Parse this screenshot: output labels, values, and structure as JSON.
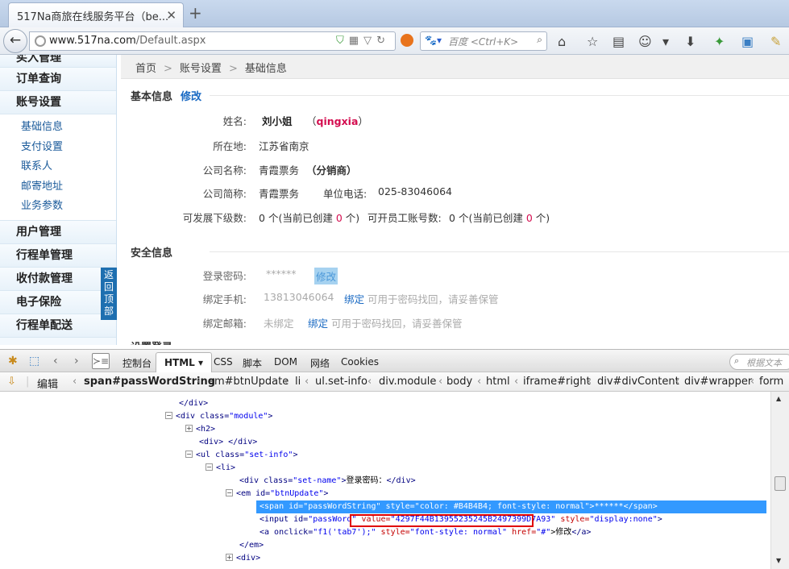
{
  "browser": {
    "tab_title": "517Na商旅在线服务平台（be...",
    "url_host": "www.517na.com",
    "url_path": "/Default.aspx",
    "search_placeholder": "百度 <Ctrl+K>"
  },
  "sidebar": {
    "items": [
      {
        "label": "买入管理",
        "type": "main"
      },
      {
        "label": "订单查询",
        "type": "main"
      },
      {
        "label": "账号设置",
        "type": "main"
      }
    ],
    "sub_items": [
      "基础信息",
      "支付设置",
      "联系人",
      "邮寄地址",
      "业务参数"
    ],
    "items_after": [
      "用户管理",
      "行程单管理",
      "收付款管理",
      "电子保险",
      "行程单配送"
    ],
    "back_to_top": [
      "返",
      "回",
      "顶",
      "部"
    ]
  },
  "breadcrumb": [
    "首页",
    "账号设置",
    "基础信息"
  ],
  "basic_info": {
    "title": "基本信息",
    "edit_link": "修改",
    "name_label": "姓名:",
    "name_value": "刘小姐",
    "username": "qingxia",
    "location_label": "所在地:",
    "location_value": "江苏省南京",
    "company_label": "公司名称:",
    "company_value": "青霞票务",
    "company_type": "分销商",
    "short_label": "公司简称:",
    "short_value": "青霞票务",
    "phone_label": "单位电话:",
    "phone_value": "025-83046064",
    "sub_label": "可发展下级数:",
    "sub_count": "0",
    "sub_text_a": "个(当前已创建",
    "sub_created": "0",
    "sub_text_b": "个)",
    "staff_label": "可开员工账号数:",
    "staff_count": "0",
    "staff_created": "0"
  },
  "security_info": {
    "title": "安全信息",
    "password_label": "登录密码:",
    "password_mask": "******",
    "password_edit": "修改",
    "phone_label": "绑定手机:",
    "phone_value": "13813046064",
    "bind_link": "绑定",
    "bind_hint": "可用于密码找回，请妥善保管",
    "email_label": "绑定邮箱:",
    "email_value": "未绑定",
    "email_bind_link": "绑定",
    "email_hint": "可用于密码找回，请妥善保管",
    "next_section_partial": "设置登录"
  },
  "firebug": {
    "tabs": [
      "控制台",
      "HTML",
      "CSS",
      "脚本",
      "DOM",
      "网络",
      "Cookies"
    ],
    "active_tab": "HTML",
    "search_placeholder": "根据文本",
    "edit_label": "编辑",
    "crumbs": [
      "span#passWordString",
      "em#btnUpdate",
      "li",
      "ul.set-info",
      "div.module",
      "body",
      "html",
      "iframe#right",
      "div#divContent",
      "div#wrapper",
      "form"
    ],
    "lines": [
      {
        "tag": "</div>"
      },
      {
        "open": "<div class=",
        "cls": "\"module\"",
        "close": ">"
      },
      {
        "text": "<h2>"
      },
      {
        "text": "<div> </div>"
      },
      {
        "open": "<ul class=",
        "cls": "\"set-info\"",
        "close": ">"
      },
      {
        "text": "<li>"
      },
      {
        "open": "<div class=",
        "cls": "\"set-name\"",
        "close": ">",
        "inner": "登录密码：",
        "end": "</div>"
      },
      {
        "open": "<em id=",
        "cls": "\"btnUpdate\"",
        "close": ">"
      },
      {
        "span_open": "<span id=",
        "span_id": "\"passWordString\"",
        "span_style_attr": " style=",
        "span_style": "\"color: #B4B4B4; font-style: normal\"",
        "span_inner": ">******",
        "span_end": "</span>"
      },
      {
        "input_open": "<input id=",
        "input_id": "\"passWord\"",
        "value_attr": " value=",
        "value": "\"4297F44B13955235245B2497399D7A93\"",
        "style_attr": " style=",
        "style_val": "\"display:none\"",
        "tail": ">"
      },
      {
        "a_open": "<a onclick=",
        "onclick": "\"f1('tab7');\"",
        "style_attr": " style=",
        "style_val": "\"font-style: normal\"",
        "href_attr": " href=",
        "href_val": "\"#\"",
        "inner": ">修改",
        "end": "</a>"
      },
      {
        "text": "</em>"
      },
      {
        "text": "<div>"
      }
    ]
  }
}
